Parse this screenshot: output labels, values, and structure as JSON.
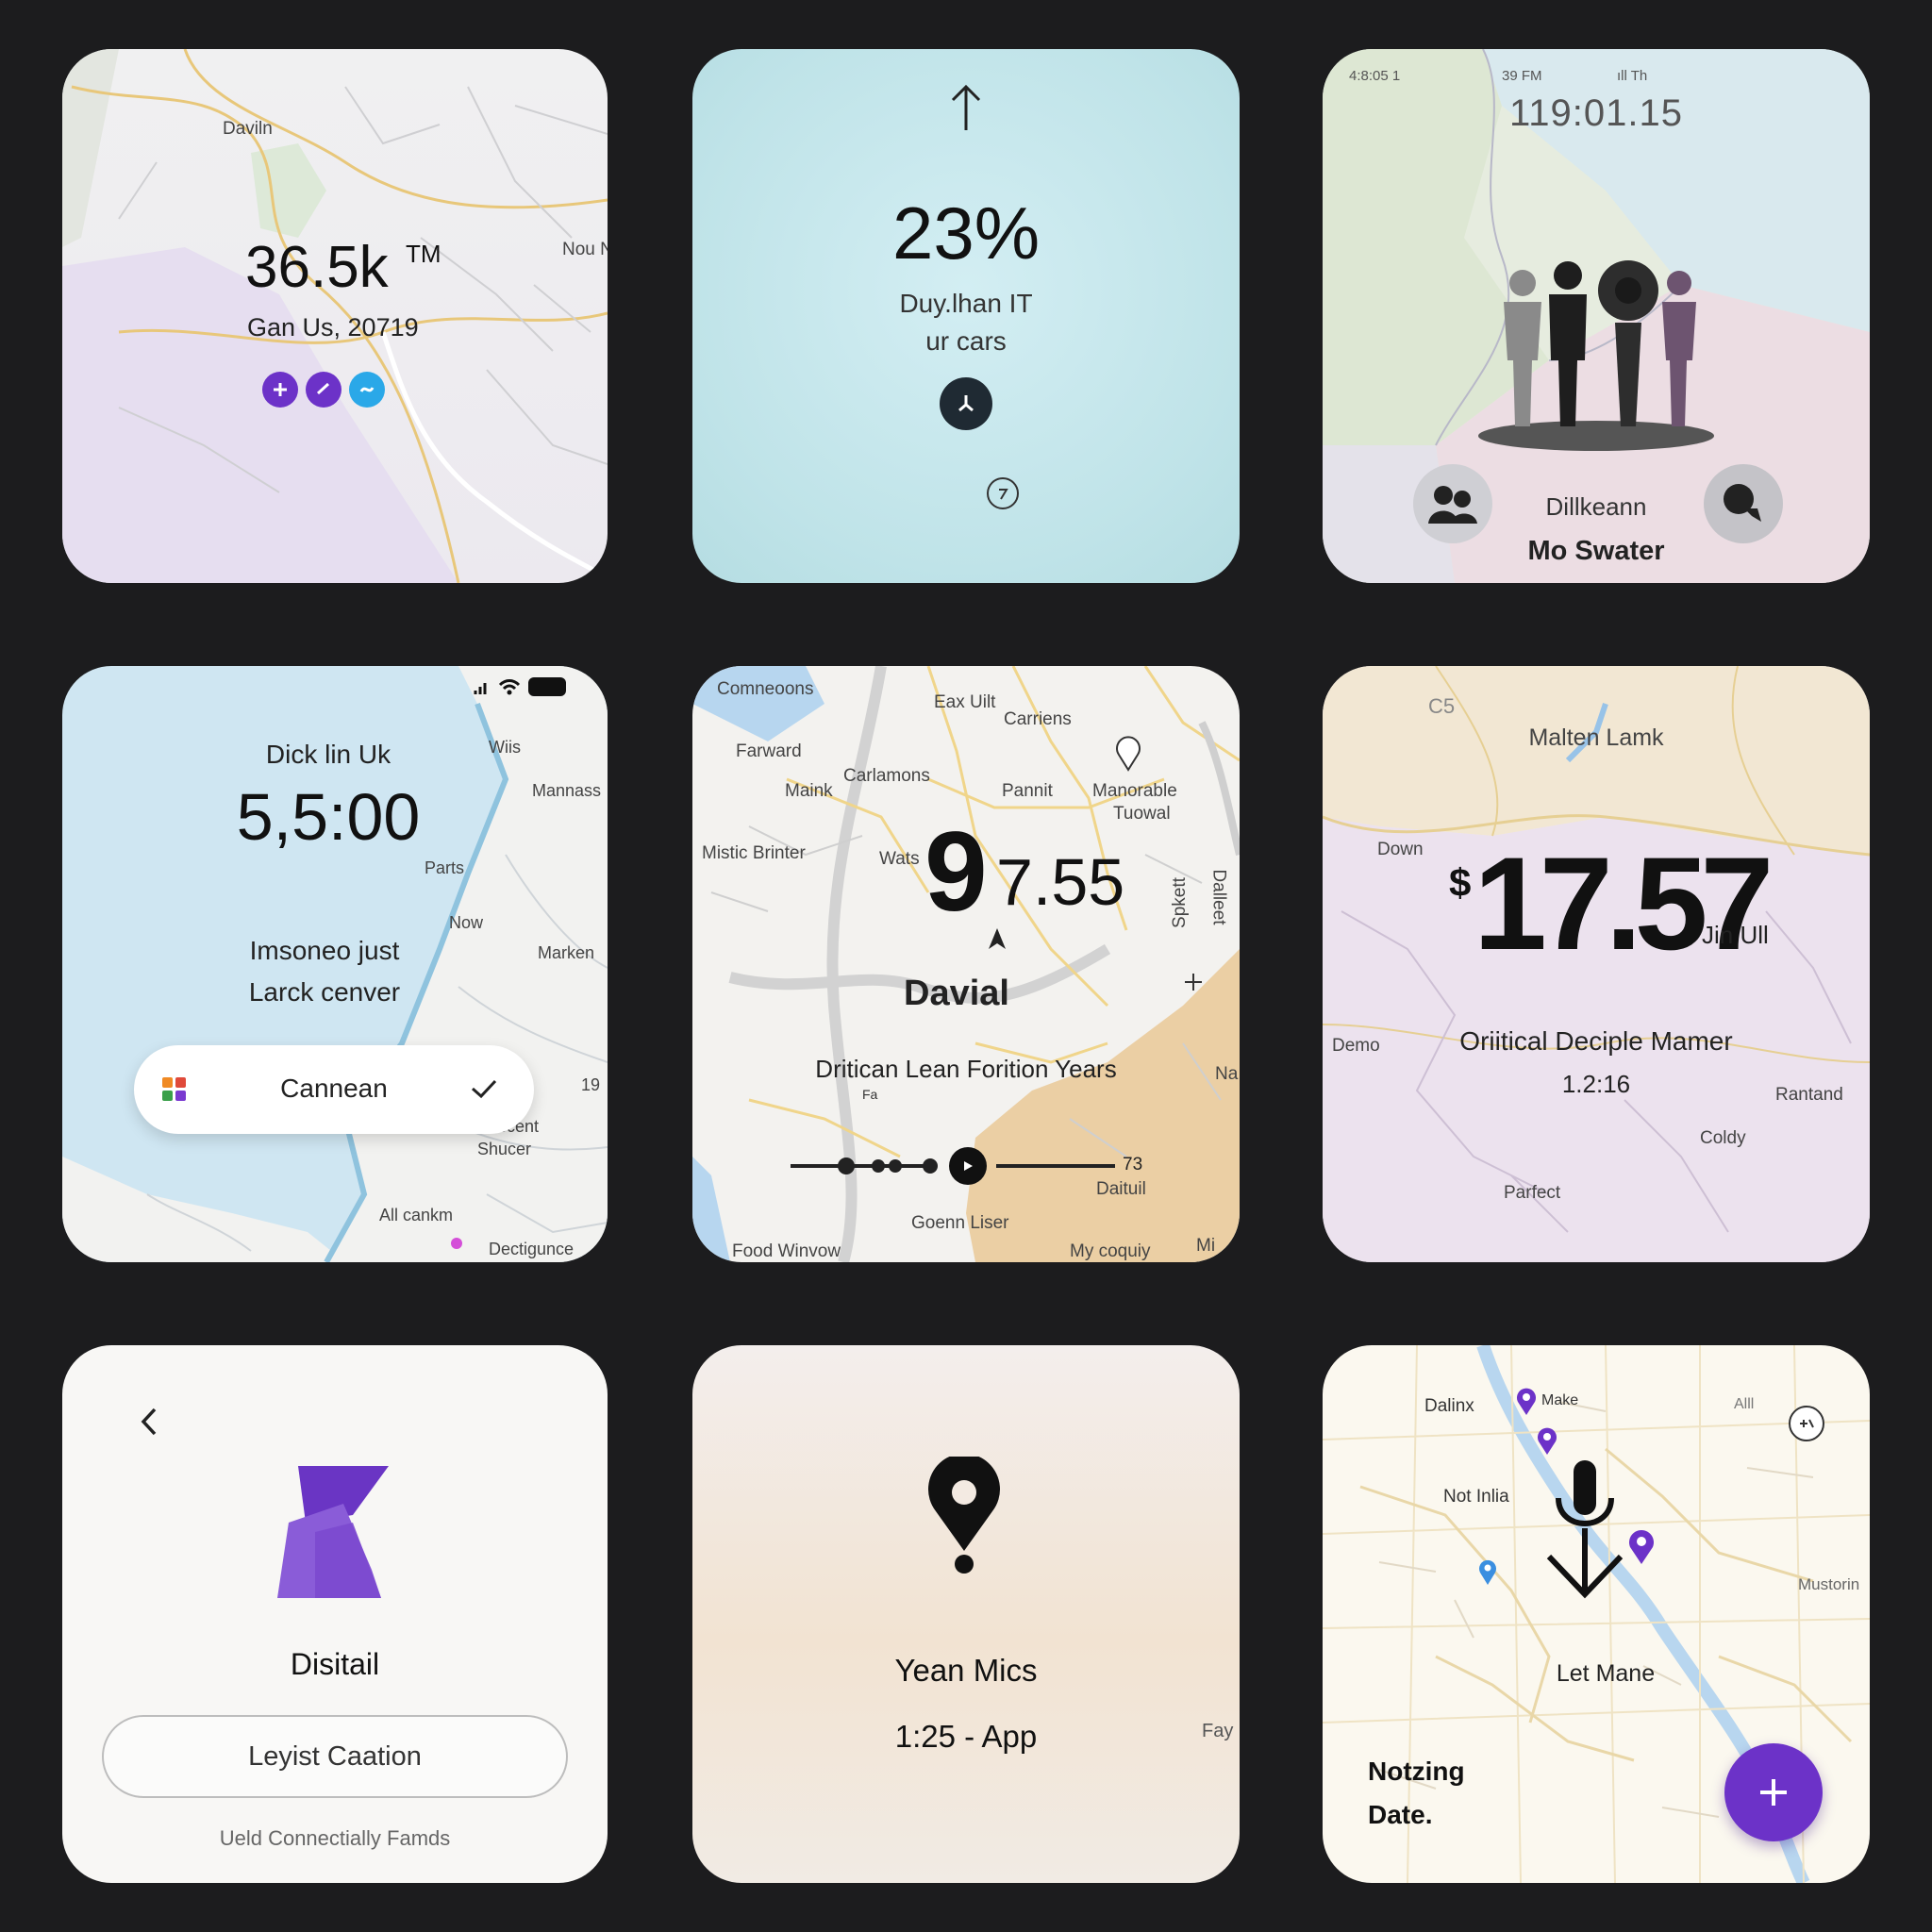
{
  "colors": {
    "page_background": "#1c1c1e",
    "accent_purple": "#6c32c8",
    "accent_blue": "#2aa8e8",
    "dark_icon": "#1f2a33"
  },
  "card1": {
    "map_labels": {
      "davin": "Daviln",
      "nou": "Nou N"
    },
    "value": "36.5k",
    "value_suffix": "TM",
    "subtitle": "Gan Us, 20719",
    "action_icons": [
      "plus-icon",
      "check-icon",
      "link-icon"
    ]
  },
  "card2": {
    "percent": "23%",
    "line1": "Duy.lhan IT",
    "line2": "ur cars",
    "icons": [
      "arrow-up-icon",
      "clock-icon",
      "help-icon"
    ]
  },
  "card3": {
    "status": {
      "left": "4:8:05 1",
      "center": "39 FM",
      "right": "ıll Th"
    },
    "clock": "119:01.15",
    "name": "Dillkeann",
    "title": "Mo Swater",
    "icons": [
      "people-figures-icon",
      "group-icon",
      "chat-icon"
    ]
  },
  "card4": {
    "heading": "Dick lin Uk",
    "time": "5,5:00",
    "line1": "Imsoneo just",
    "line2": "Larck cenver",
    "pill_label": "Cannean",
    "map_labels": {
      "wiis": "Wiis",
      "mannass": "Mannass",
      "parts": "Parts",
      "now": "Now",
      "marken": "Marken",
      "num": "19",
      "accent": "Accent",
      "shucer": "Shucer",
      "allcankm": "All cankm",
      "dectigunce": "Dectigunce"
    },
    "icons": [
      "signal-icon",
      "wifi-icon",
      "battery-icon",
      "app-grid-icon",
      "check-icon"
    ]
  },
  "card5": {
    "big_digit": "9",
    "value": "7.55",
    "name": "Davial",
    "subtitle": "Dritican Lean Forition Years",
    "subtitle_small": "Fa",
    "slider_end": "73",
    "slider_level": 0.5,
    "map_labels": {
      "comneoons": "Comneoons",
      "eaxuilt": "Eax Uilt",
      "carriens": "Carriens",
      "farward": "Farward",
      "carlamons": "Carlamons",
      "maink": "Maink",
      "pannit": "Pannit",
      "manorable": "Manorable",
      "tuowal": "Tuowal",
      "mistic": "Mistic Brinter",
      "wats": "Wats",
      "spkett": "Spkett",
      "dalleet": "Dalleet",
      "na": "Na",
      "daituil": "Daituil",
      "goenn": "Goenn Liser",
      "food": "Food Winvow",
      "mycoquiy": "My coquiy",
      "mi": "Mi"
    },
    "icons": [
      "pin-icon",
      "navigation-arrow-icon",
      "play-icon",
      "plus-icon"
    ]
  },
  "card6": {
    "map_labels": {
      "c5": "C5",
      "malten": "Malten Lamk",
      "down": "Down",
      "demo": "Demo",
      "rantand": "Rantand",
      "coldy": "Coldy",
      "parfect": "Parfect"
    },
    "currency": "$",
    "value": "17.57",
    "unit": "Jin Ull",
    "subtitle": "Oriitical Deciple Mamer",
    "time": "1.2:16"
  },
  "card7": {
    "title": "Disitail",
    "button_label": "Leyist Caation",
    "footer": "Ueld Connectially Famds",
    "icons": [
      "back-chevron-icon",
      "app-logo-icon"
    ]
  },
  "card8": {
    "title": "Yean Mics",
    "subtitle": "1:25 - App",
    "edge_label": "Fay",
    "icons": [
      "location-pin-icon"
    ]
  },
  "card9": {
    "map_labels": {
      "dalinx": "Dalinx",
      "make": "Make",
      "alll": "Alll",
      "notinlia": "Not Inlia",
      "mustorin": "Mustorin",
      "letmane": "Let Mane"
    },
    "title_line1": "Notzing",
    "title_line2": "Date.",
    "icons": [
      "microphone-icon",
      "download-arrow-icon",
      "add-location-icon",
      "map-pin-icon",
      "plus-icon"
    ]
  }
}
